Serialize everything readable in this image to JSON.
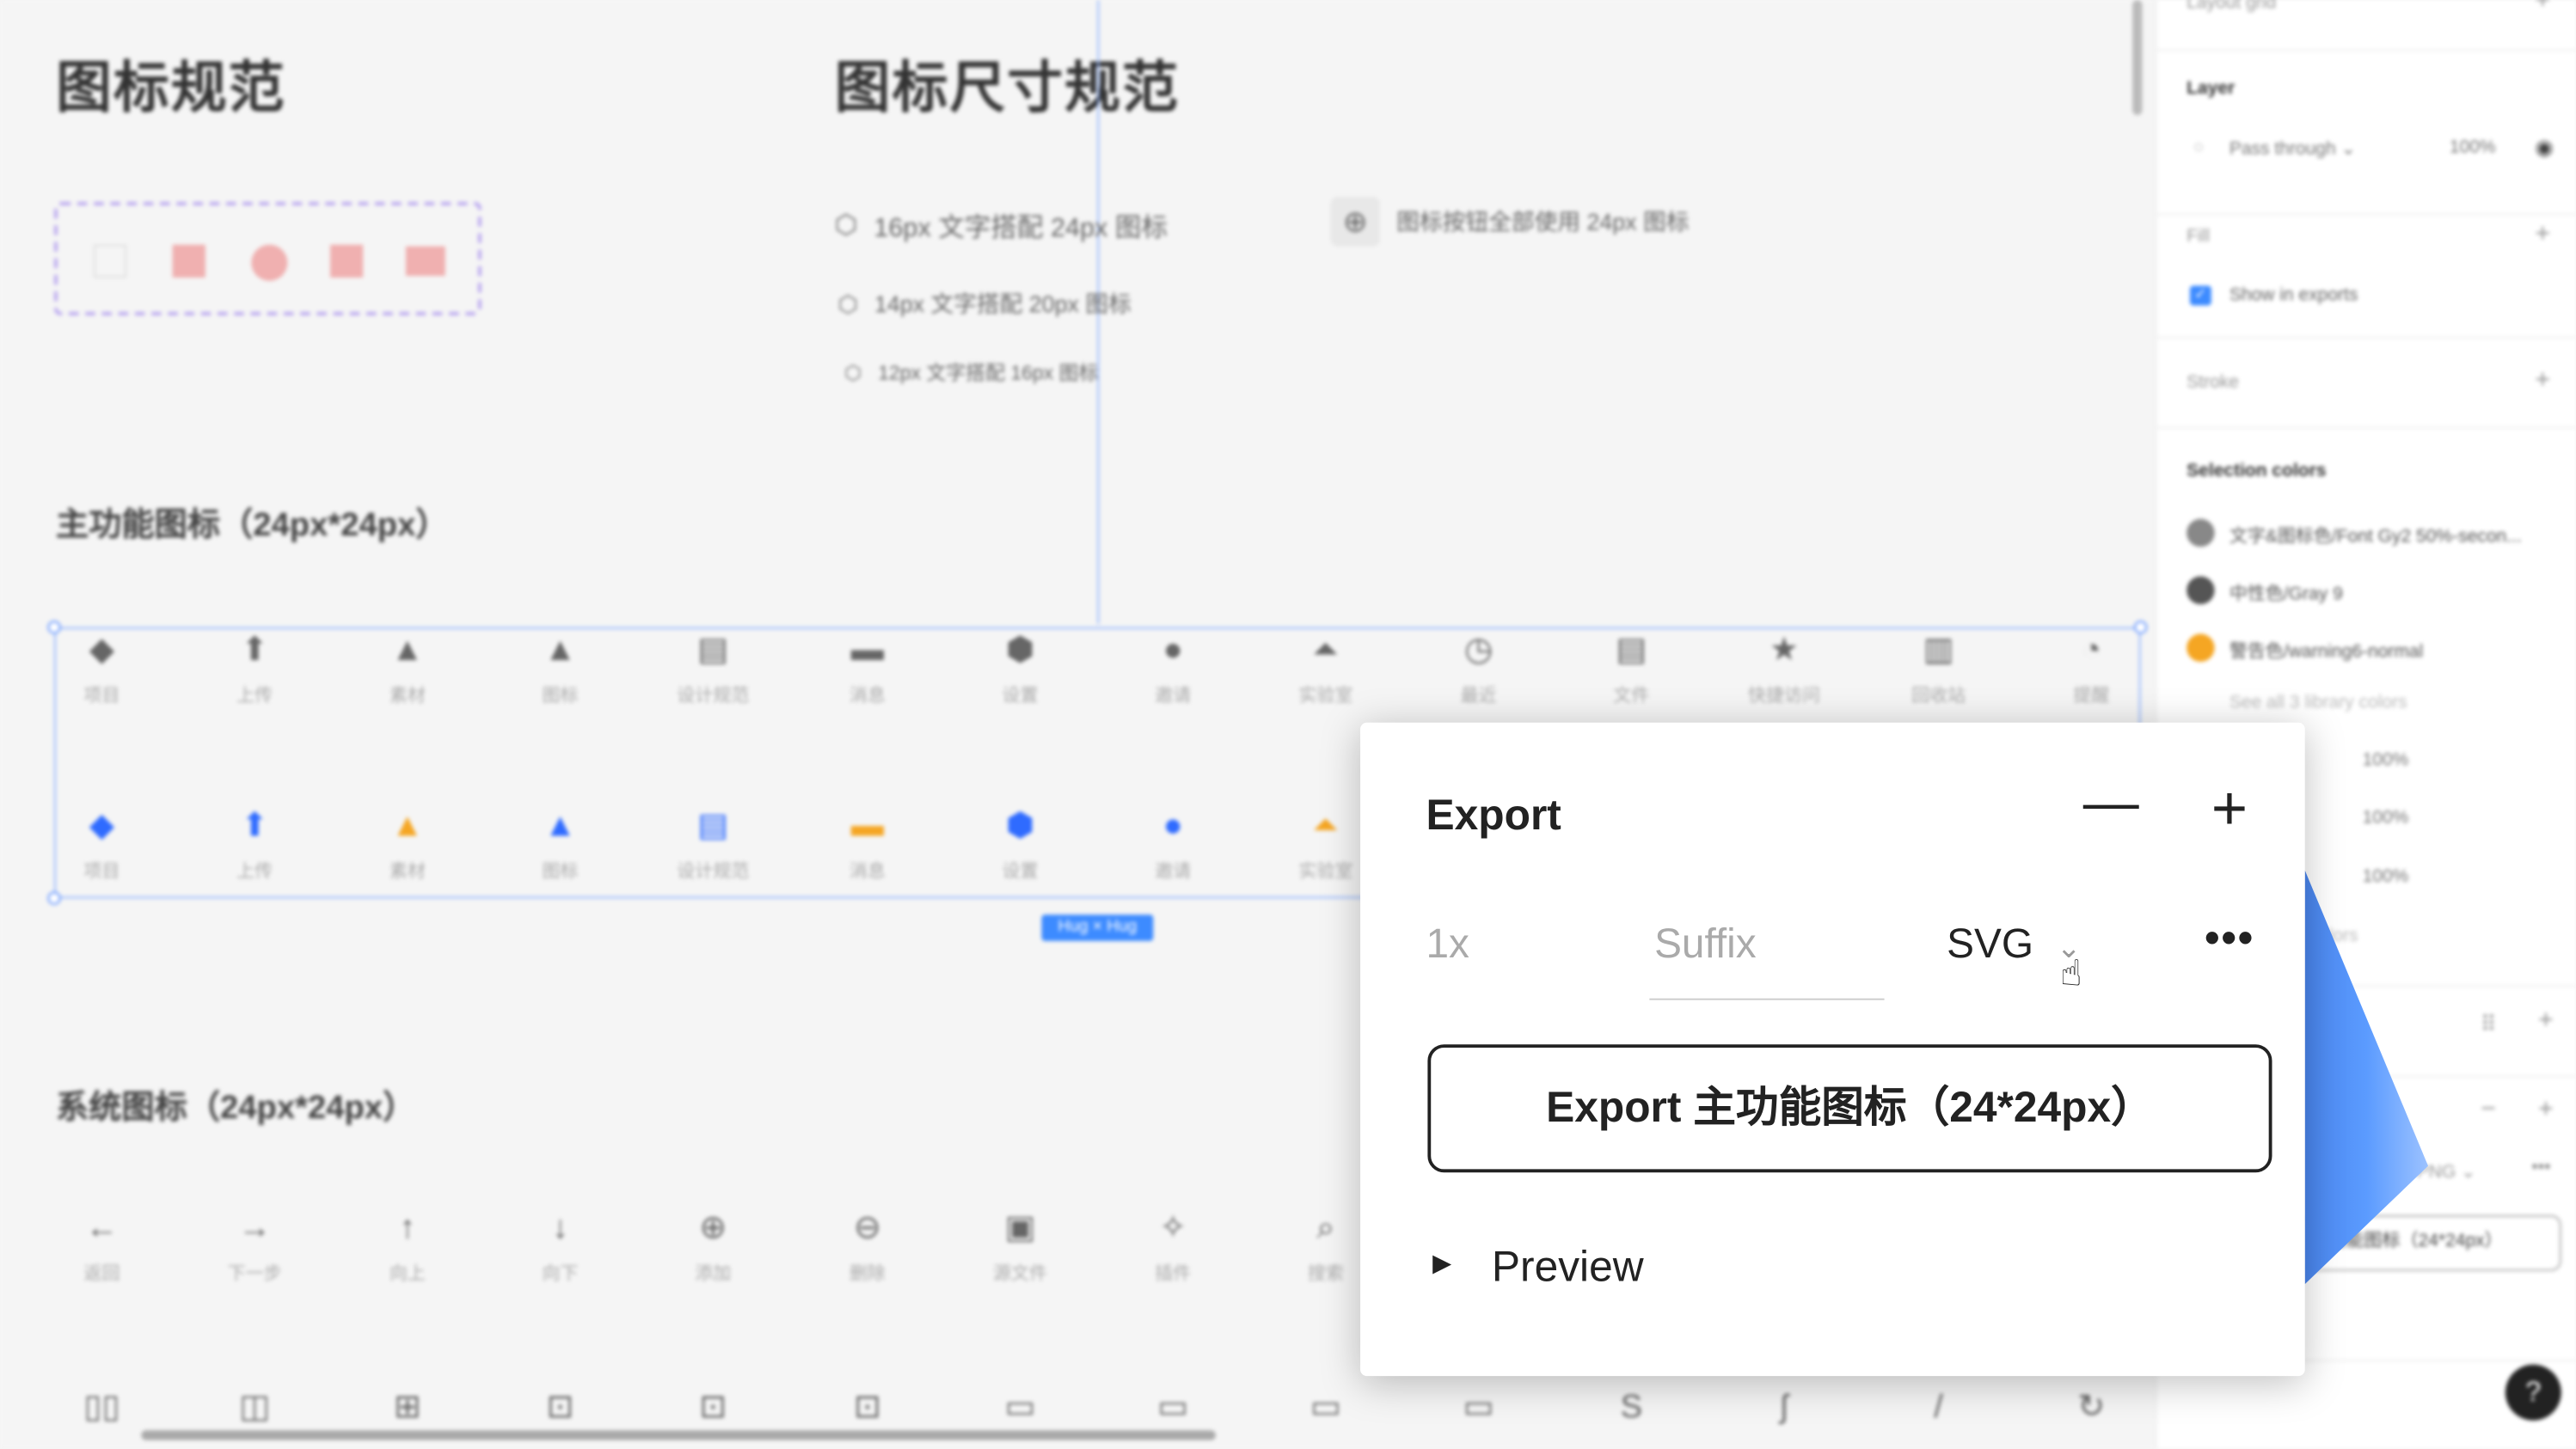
{
  "canvas": {
    "title_left": "图标规范",
    "title_right": "图标尺寸规范",
    "size_rules": [
      "16px 文字搭配 24px 图标",
      "14px 文字搭配 20px 图标",
      "12px 文字搭配 16px 图标"
    ],
    "button_rule": "图标按钮全部使用 24px 图标",
    "main_section": "主功能图标（24px*24px）",
    "main_labels": [
      "项目",
      "上传",
      "素材",
      "图标",
      "设计规范",
      "消息",
      "设置",
      "邀请",
      "实验室",
      "最近",
      "文件",
      "快捷访问",
      "回收站",
      "提醒"
    ],
    "main_glyphs": [
      "◆",
      "⬆",
      "▲",
      "▲",
      "▤",
      "▬",
      "⬢",
      "●",
      "⏶",
      "◷",
      "▤",
      "★",
      "▥",
      "◔"
    ],
    "hug_badge": "Hug × Hug",
    "system_section": "系统图标（24px*24px）",
    "system_labels": [
      "返回",
      "下一步",
      "向上",
      "向下",
      "添加",
      "删除",
      "源文件",
      "插件",
      "搜索"
    ],
    "system_glyphs": [
      "←",
      "→",
      "↑",
      "↓",
      "⊕",
      "⊖",
      "▣",
      "✧",
      "⌕"
    ],
    "system_row2_glyphs": [
      "▯▯",
      "◫",
      "⊞",
      "⊡",
      "⊡",
      "⊡",
      "▭",
      "▭",
      "▭",
      "▭",
      "S",
      "ʃ",
      "/",
      "↻"
    ],
    "accent": "#2f6bff",
    "warning": "#f5a623"
  },
  "panel": {
    "layout_grid": "Layout grid",
    "layer": "Layer",
    "blend": "Pass through",
    "opacity": "100%",
    "fill": "Fill",
    "show_in_exports": "Show in exports",
    "stroke": "Stroke",
    "selection_colors": "Selection colors",
    "colors": [
      {
        "name": "文字&图标色/Font Gy2 50%-secon...",
        "hex": "#888888"
      },
      {
        "name": "中性色/Gray 9",
        "hex": "#555555"
      },
      {
        "name": "警告色/warning6-normal",
        "hex": "#f5a623"
      }
    ],
    "see_all": "See all 3 library colors",
    "opacities": [
      "100%",
      "100%",
      "100%"
    ],
    "colors_tail": "colors",
    "format": "PNG",
    "export_button": "主功能图标（24*24px）",
    "help": "?"
  },
  "export": {
    "title": "Export",
    "scale": "1x",
    "suffix_placeholder": "Suffix",
    "format": "SVG",
    "button": "Export 主功能图标（24*24px）",
    "preview": "Preview"
  }
}
